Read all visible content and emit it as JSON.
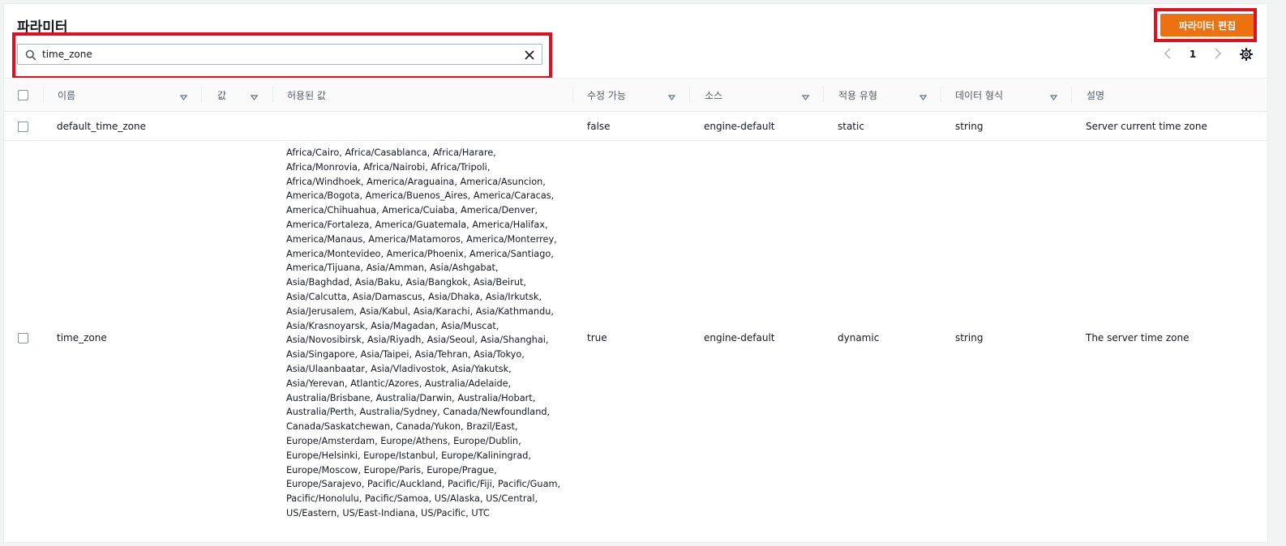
{
  "header": {
    "title": "파라미터",
    "edit_button": "파라미터 편집"
  },
  "search": {
    "value": "time_zone"
  },
  "pagination": {
    "current_page": "1"
  },
  "table": {
    "columns": [
      "이름",
      "값",
      "허용된 값",
      "수정 가능",
      "소스",
      "적용 유형",
      "데이터 형식",
      "설명"
    ],
    "rows": [
      {
        "name": "default_time_zone",
        "value": "",
        "allowed": "",
        "modifiable": "false",
        "source": "engine-default",
        "apply_type": "static",
        "data_type": "string",
        "description": "Server current time zone"
      },
      {
        "name": "time_zone",
        "value": "",
        "allowed": "Africa/Cairo, Africa/Casablanca, Africa/Harare, Africa/Monrovia, Africa/Nairobi, Africa/Tripoli, Africa/Windhoek, America/Araguaina, America/Asuncion, America/Bogota, America/Buenos_Aires, America/Caracas, America/Chihuahua, America/Cuiaba, America/Denver, America/Fortaleza, America/Guatemala, America/Halifax, America/Manaus, America/Matamoros, America/Monterrey, America/Montevideo, America/Phoenix, America/Santiago, America/Tijuana, Asia/Amman, Asia/Ashgabat, Asia/Baghdad, Asia/Baku, Asia/Bangkok, Asia/Beirut, Asia/Calcutta, Asia/Damascus, Asia/Dhaka, Asia/Irkutsk, Asia/Jerusalem, Asia/Kabul, Asia/Karachi, Asia/Kathmandu, Asia/Krasnoyarsk, Asia/Magadan, Asia/Muscat, Asia/Novosibirsk, Asia/Riyadh, Asia/Seoul, Asia/Shanghai, Asia/Singapore, Asia/Taipei, Asia/Tehran, Asia/Tokyo, Asia/Ulaanbaatar, Asia/Vladivostok, Asia/Yakutsk, Asia/Yerevan, Atlantic/Azores, Australia/Adelaide, Australia/Brisbane, Australia/Darwin, Australia/Hobart, Australia/Perth, Australia/Sydney, Canada/Newfoundland, Canada/Saskatchewan, Canada/Yukon, Brazil/East, Europe/Amsterdam, Europe/Athens, Europe/Dublin, Europe/Helsinki, Europe/Istanbul, Europe/Kaliningrad, Europe/Moscow, Europe/Paris, Europe/Prague, Europe/Sarajevo, Pacific/Auckland, Pacific/Fiji, Pacific/Guam, Pacific/Honolulu, Pacific/Samoa, US/Alaska, US/Central, US/Eastern, US/East-Indiana, US/Pacific, UTC",
        "modifiable": "true",
        "source": "engine-default",
        "apply_type": "dynamic",
        "data_type": "string",
        "description": "The server time zone"
      }
    ]
  },
  "icons": {
    "search": "search-icon",
    "clear": "close-icon",
    "prev": "chevron-left-icon",
    "next": "chevron-right-icon",
    "settings": "gear-icon",
    "sort": "caret-down-icon"
  },
  "colors": {
    "primary_button": "#ec7211",
    "highlight_box": "#e0101e"
  }
}
